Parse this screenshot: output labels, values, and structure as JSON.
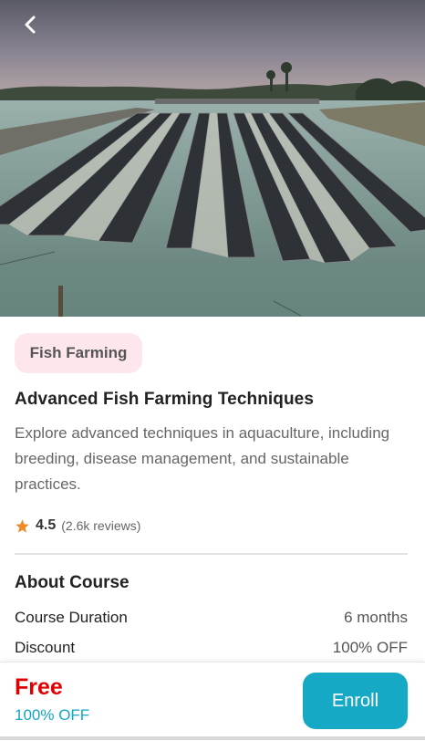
{
  "header": {
    "back_icon": "chevron-left-icon"
  },
  "hero": {
    "alt_subject": "fish-farm-ponds-photo"
  },
  "course": {
    "category": "Fish Farming",
    "title": "Advanced Fish Farming Techniques",
    "description": "Explore advanced techniques in aquaculture, including breeding, disease management, and sustainable practices.",
    "rating": "4.5",
    "reviews": "(2.6k reviews)",
    "star_color": "#f08a24"
  },
  "about": {
    "title": "About Course",
    "rows": [
      {
        "label": "Course Duration",
        "value": "6 months"
      },
      {
        "label": "Discount",
        "value": "100% OFF"
      }
    ]
  },
  "footer": {
    "price": "Free",
    "discount": "100% OFF",
    "enroll_label": "Enroll",
    "accent": "#16a9c5",
    "price_color": "#e00000"
  }
}
